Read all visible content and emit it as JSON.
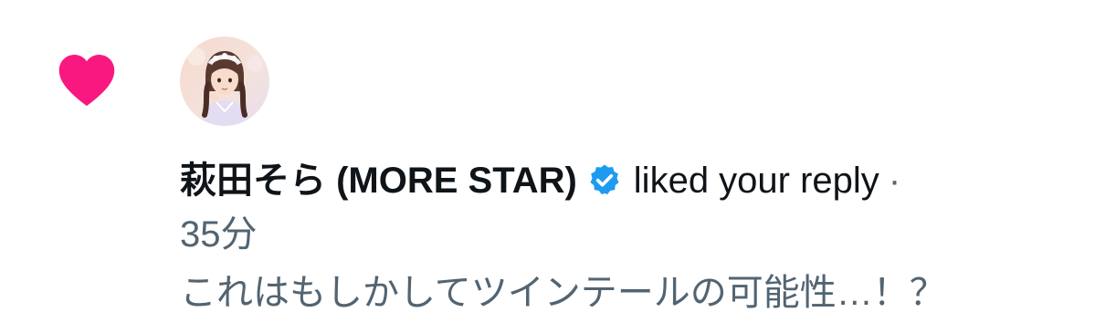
{
  "notification": {
    "type_icon": "heart-icon",
    "avatar_icon": "user-avatar",
    "user_name": "萩田そら (MORE STAR)",
    "verified_icon": "verified-badge-icon",
    "action": "liked your reply",
    "separator": "·",
    "time": "35分",
    "reply_text": "これはもしかしてツインテールの可能性…！？"
  },
  "colors": {
    "heart": "#f91880",
    "verified": "#1d9bf0",
    "primary_text": "#0f1419",
    "secondary_text": "#536471"
  }
}
